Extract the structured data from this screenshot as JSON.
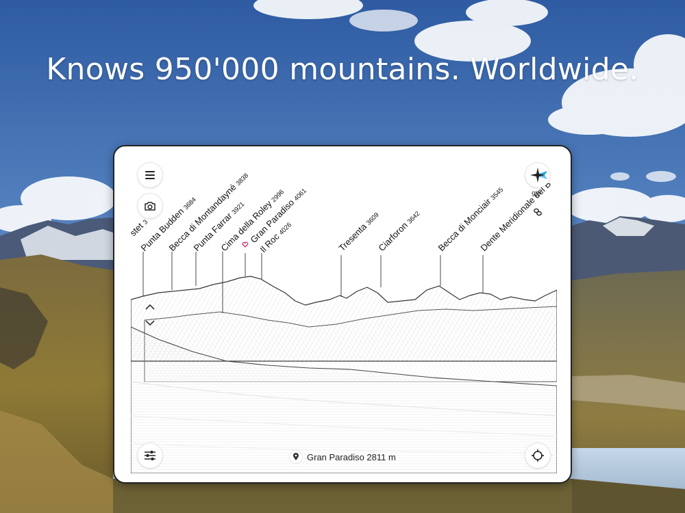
{
  "headline": "Knows 950'000 mountains. Worldwide.",
  "colors": {
    "sky_top": "#2f5ca3",
    "sky_bottom": "#a9c6e6",
    "accent_favorite": "#e0206f",
    "compass_arrow": "#19a9e8"
  },
  "icons": {
    "menu": "menu-icon",
    "camera": "camera-icon",
    "compass": "compass-icon",
    "link": "link-icon",
    "up": "chevron-up-icon",
    "down": "chevron-down-icon",
    "filters": "sliders-icon",
    "location": "location-pin-icon",
    "recenter": "crosshair-icon",
    "favorite": "heart-icon"
  },
  "compass": {
    "heading": "92°"
  },
  "location": {
    "label": "Gran Paradiso 2811 m"
  },
  "peaks": [
    {
      "name": "stet",
      "elevation": "3",
      "favorite": false
    },
    {
      "name": "Punta Budden",
      "elevation": "3684",
      "favorite": false
    },
    {
      "name": "Becca di Montandayné",
      "elevation": "3838",
      "favorite": false
    },
    {
      "name": "Punta Farrar",
      "elevation": "3921",
      "favorite": false
    },
    {
      "name": "Cima della Roley",
      "elevation": "2996",
      "favorite": false
    },
    {
      "name": "Gran Paradiso",
      "elevation": "4061",
      "favorite": true
    },
    {
      "name": "Il Roc",
      "elevation": "4026",
      "favorite": false
    },
    {
      "name": "Tresenta",
      "elevation": "3609",
      "favorite": false
    },
    {
      "name": "Ciarforon",
      "elevation": "3642",
      "favorite": false
    },
    {
      "name": "Becca di Monciair",
      "elevation": "3545",
      "favorite": false
    },
    {
      "name": "Dente Meridionale del B",
      "elevation": "",
      "favorite": false
    }
  ]
}
